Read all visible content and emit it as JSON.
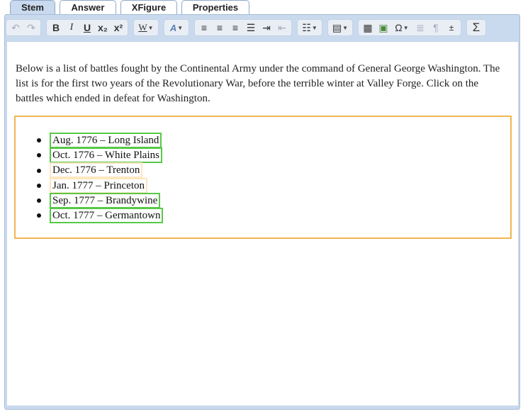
{
  "tabs": [
    "Stem",
    "Answer",
    "XFigure",
    "Properties"
  ],
  "toolbar": {
    "bold": "B",
    "italic": "I",
    "underline": "U",
    "subscript": "x₂",
    "superscript": "x²",
    "word_count": "W",
    "special_char": "Ω",
    "pilcrow": "¶",
    "sigma": "Σ"
  },
  "content": {
    "intro": "Below is a list of battles fought by the Continental Army under the command of General George Washington. The list is for the first two years of the Revolutionary War, before the terrible winter at Valley Forge. Click on the battles which ended in defeat for Washington.",
    "options": [
      {
        "text": "Aug. 1776 – Long Island",
        "selected": true
      },
      {
        "text": "Oct. 1776 – White Plains",
        "selected": true
      },
      {
        "text": "Dec. 1776 – Trenton",
        "selected": false
      },
      {
        "text": "Jan. 1777 – Princeton",
        "selected": false
      },
      {
        "text": "Sep. 1777 – Brandywine",
        "selected": true
      },
      {
        "text": "Oct. 1777 – Germantown",
        "selected": true
      }
    ]
  },
  "colors": {
    "selected_border": "#57c847",
    "unselected_border": "#fde6bf",
    "answer_box_border": "#f0b551",
    "frame": "#c9d9ee"
  }
}
